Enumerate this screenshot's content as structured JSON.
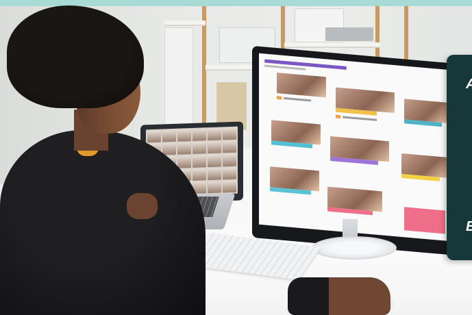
{
  "photo": {
    "description_kind": "stock-photo",
    "background_color": "#e9ecea",
    "accent_strip_color": "#a9dbd6"
  },
  "overlay_card": {
    "color": "#17383a",
    "text_top": "A",
    "text_bottom": "E"
  },
  "monitor": {
    "accent_color": "#7a57c4",
    "pink_block_color": "#ef6e8a"
  }
}
